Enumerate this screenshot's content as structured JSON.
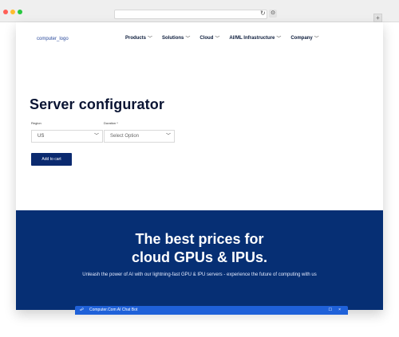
{
  "browser": {
    "reload_icon": "↻",
    "extension_icon": "⊙",
    "new_tab_icon": "+"
  },
  "header": {
    "logo": "computer_logo",
    "nav": [
      {
        "label": "Products"
      },
      {
        "label": "Solutions"
      },
      {
        "label": "Cloud"
      },
      {
        "label": "AI/ML Infrastructure"
      },
      {
        "label": "Company"
      }
    ],
    "chevron": "﹀"
  },
  "configurator": {
    "title": "Server configurator",
    "region_label": "Region",
    "region_value": "US",
    "duration_label": "Duration *",
    "duration_value": "Select Option",
    "add_to_cart": "Add to cart"
  },
  "hero": {
    "title_line1": "The best prices for",
    "title_line2": "cloud GPUs & IPUs.",
    "subtitle": "Unleash the power of AI with our lightning-fast GPU & IPU servers - experience the future of computing with us"
  },
  "chat": {
    "title": "Computer.Com AI Chat Bot",
    "icon": "☍",
    "maximize_icon": "☐",
    "close_icon": "×"
  },
  "colors": {
    "accent": "#062f74",
    "button": "#0b2a6f",
    "chat": "#1f61d9"
  }
}
